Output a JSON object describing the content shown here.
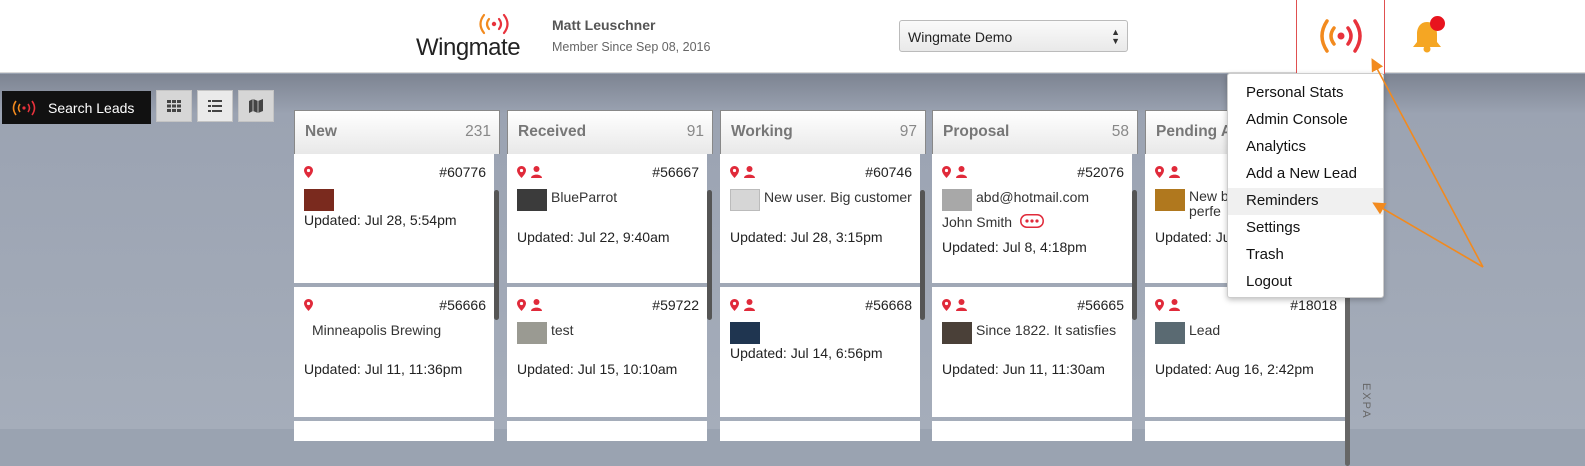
{
  "header": {
    "logo_text": "Wingmate",
    "user_name": "Matt Leuschner",
    "member_since": "Member Since Sep 08, 2016",
    "org_select_value": "Wingmate Demo"
  },
  "toolbar": {
    "search_label": "Search Leads",
    "views": [
      "grid-view-icon",
      "list-view-icon",
      "map-view-icon"
    ]
  },
  "columns": [
    {
      "title": "New",
      "count": "231",
      "cards": [
        {
          "icons": [
            "pin"
          ],
          "number": "#60776",
          "desc": "",
          "thumb": "#7a2a1e",
          "updated": "Updated: Jul 28, 5:54pm"
        },
        {
          "icons": [
            "pin"
          ],
          "number": "#56666",
          "desc": "Minneapolis Brewing",
          "thumb": "",
          "updated": "Updated: Jul 11, 11:36pm"
        }
      ]
    },
    {
      "title": "Received",
      "count": "91",
      "cards": [
        {
          "icons": [
            "pin",
            "person"
          ],
          "number": "#56667",
          "desc": "BlueParrot",
          "thumb": "#3b3b3b",
          "updated": "Updated: Jul 22, 9:40am"
        },
        {
          "icons": [
            "pin",
            "person"
          ],
          "number": "#59722",
          "desc": "test",
          "thumb": "#9a9a92",
          "updated": "Updated: Jul 15, 10:10am"
        }
      ]
    },
    {
      "title": "Working",
      "count": "97",
      "cards": [
        {
          "icons": [
            "pin",
            "person"
          ],
          "number": "#60746",
          "desc": "New user. Big customer",
          "thumb": "#d6d6d6",
          "updated": "Updated: Jul 28, 3:15pm"
        },
        {
          "icons": [
            "pin",
            "person"
          ],
          "number": "#56668",
          "desc": "",
          "thumb": "#1f3550",
          "updated": "Updated: Jul 14, 6:56pm"
        }
      ]
    },
    {
      "title": "Proposal",
      "count": "58",
      "cards": [
        {
          "icons": [
            "pin",
            "person"
          ],
          "number": "#52076",
          "desc": "abd@hotmail.com",
          "desc2": "John Smith",
          "thumb": "#a8a8a8",
          "updated": "Updated: Jul 8, 4:18pm"
        },
        {
          "icons": [
            "pin",
            "person"
          ],
          "number": "#56665",
          "desc": "Since 1822. It satisfies",
          "thumb": "#4a4038",
          "updated": "Updated: Jun 11, 11:30am"
        }
      ]
    },
    {
      "title": "Pending A",
      "count": "",
      "cards": [
        {
          "icons": [
            "pin",
            "person"
          ],
          "number": "",
          "desc": "New b",
          "desc2": "perfe",
          "thumb": "#b0781e",
          "updated": "Updated: Ju"
        },
        {
          "icons": [
            "pin",
            "person"
          ],
          "number": "#18018",
          "desc": "Lead",
          "thumb": "#5a6a72",
          "updated": "Updated: Aug 16, 2:42pm"
        }
      ]
    }
  ],
  "menu": {
    "items": [
      "Personal Stats",
      "Admin Console",
      "Analytics",
      "Add a New Lead",
      "Reminders",
      "Settings",
      "Trash",
      "Logout"
    ],
    "highlighted": "Reminders"
  },
  "expand_label": "EXPA",
  "colors": {
    "accent": "#e8323c",
    "orange": "#f28a1e",
    "pin": "#e02a3a"
  }
}
